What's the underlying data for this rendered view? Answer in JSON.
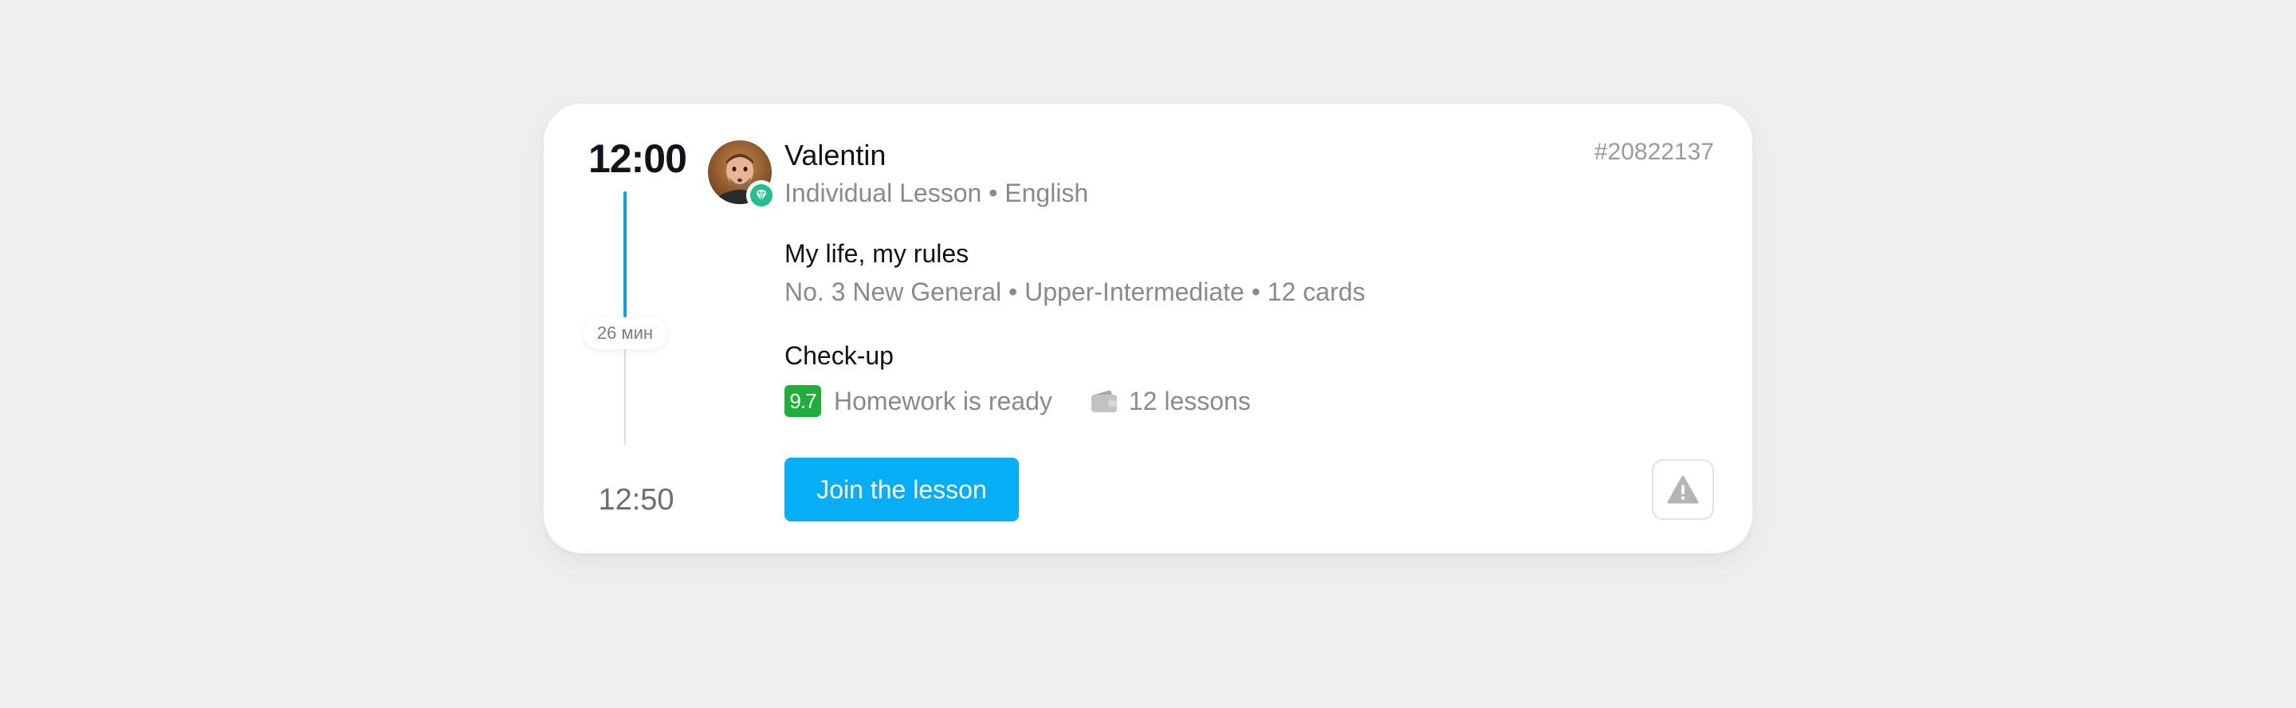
{
  "timeline": {
    "start_time": "12:00",
    "duration": "26 мин",
    "end_time": "12:50",
    "progress": 0.52
  },
  "teacher": {
    "name": "Valentin",
    "avatar_icon": "teacher-avatar",
    "badge_icon": "gem-icon"
  },
  "lesson": {
    "meta": "Individual Lesson • English",
    "id": "#20822137"
  },
  "topic": {
    "title": "My life, my rules",
    "meta": "No. 3 New General • Upper-Intermediate • 12 cards"
  },
  "check": {
    "title": "Check-up",
    "score": "9.7",
    "homework_status": "Homework is ready",
    "wallet_icon": "wallet-icon",
    "lessons_count": "12 lessons"
  },
  "actions": {
    "join_label": "Join the lesson",
    "report_icon": "warning-icon"
  },
  "colors": {
    "accent": "#06aef5",
    "timeline_active": "#0aa2e8",
    "score_green": "#1fad3b",
    "muted_text": "#8a8a8a",
    "gem": "#1fbf8f"
  }
}
